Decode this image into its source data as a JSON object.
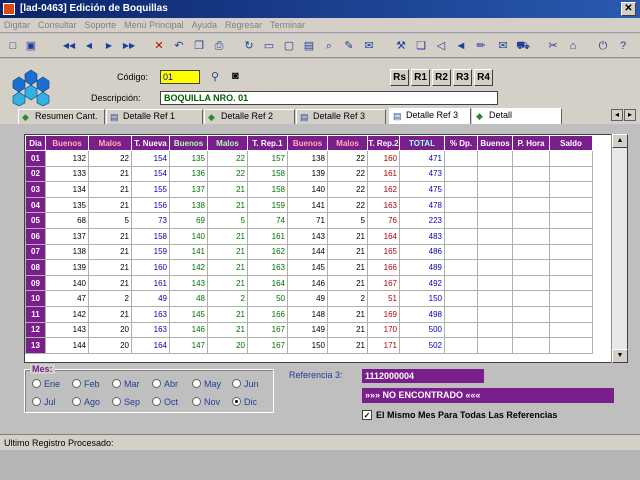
{
  "window": {
    "title": "[lad-0463]   Edición de Boquillas",
    "close": "✕"
  },
  "menu": [
    "Digitar",
    "Consultar",
    "Soporte",
    "Menú Principal",
    "Ayuda",
    "Regresar",
    "Terminar"
  ],
  "toolbar_icons": [
    "new-icon",
    "save-icon",
    "first-icon",
    "prev-icon",
    "next-icon",
    "last-icon",
    "delete-icon",
    "undo-icon",
    "copy-icon",
    "print-icon",
    "refresh-icon",
    "window-icon",
    "monitor-icon",
    "film-icon",
    "search-icon",
    "edit-icon",
    "mail-icon",
    "tool-icon",
    "book-icon",
    "back-icon",
    "sound-icon",
    "pencil-icon",
    "envelope-icon",
    "car-icon",
    "scissors-icon",
    "home-icon",
    "exit-icon",
    "help-icon"
  ],
  "form": {
    "codigo_label": "Código:",
    "codigo_value": "01",
    "descripcion_label": "Descripción:",
    "descripcion_value": "BOQUILLA NRO. 01",
    "report_buttons": [
      "Rs",
      "R1",
      "R2",
      "R3",
      "R4"
    ]
  },
  "tabs": [
    "Resumen Cant.",
    "Detalle Ref 1",
    "Detalle Ref 2",
    "Detalle Ref 3",
    "Detalle Ref 3",
    "Detall"
  ],
  "grid": {
    "headers": [
      "Dia",
      "Buenos",
      "Malos",
      "T. Nueva",
      "Buenos",
      "Malos",
      "T. Rep.1",
      "Buenos",
      "Malos",
      "T. Rep.2",
      "TOTAL",
      "% Dp.",
      "Buenos",
      "P. Hora",
      "Saldo"
    ],
    "rows": [
      [
        "01",
        "132",
        "22",
        "154",
        "135",
        "22",
        "157",
        "138",
        "22",
        "160",
        "471"
      ],
      [
        "02",
        "133",
        "21",
        "154",
        "136",
        "22",
        "158",
        "139",
        "22",
        "161",
        "473"
      ],
      [
        "03",
        "134",
        "21",
        "155",
        "137",
        "21",
        "158",
        "140",
        "22",
        "162",
        "475"
      ],
      [
        "04",
        "135",
        "21",
        "156",
        "138",
        "21",
        "159",
        "141",
        "22",
        "163",
        "478"
      ],
      [
        "05",
        "68",
        "5",
        "73",
        "69",
        "5",
        "74",
        "71",
        "5",
        "76",
        "223"
      ],
      [
        "06",
        "137",
        "21",
        "158",
        "140",
        "21",
        "161",
        "143",
        "21",
        "164",
        "483"
      ],
      [
        "07",
        "138",
        "21",
        "159",
        "141",
        "21",
        "162",
        "144",
        "21",
        "165",
        "486"
      ],
      [
        "08",
        "139",
        "21",
        "160",
        "142",
        "21",
        "163",
        "145",
        "21",
        "166",
        "489"
      ],
      [
        "09",
        "140",
        "21",
        "161",
        "143",
        "21",
        "164",
        "146",
        "21",
        "167",
        "492"
      ],
      [
        "10",
        "47",
        "2",
        "49",
        "48",
        "2",
        "50",
        "49",
        "2",
        "51",
        "150"
      ],
      [
        "11",
        "142",
        "21",
        "163",
        "145",
        "21",
        "166",
        "148",
        "21",
        "169",
        "498"
      ],
      [
        "12",
        "143",
        "20",
        "163",
        "146",
        "21",
        "167",
        "149",
        "21",
        "170",
        "500"
      ],
      [
        "13",
        "144",
        "20",
        "164",
        "147",
        "20",
        "167",
        "150",
        "21",
        "171",
        "502"
      ]
    ]
  },
  "mes": {
    "label": "Mes:",
    "options": [
      "Ene",
      "Feb",
      "Mar",
      "Abr",
      "May",
      "Jun",
      "Jul",
      "Ago",
      "Sep",
      "Oct",
      "Nov",
      "Dic"
    ],
    "selected": "Dic"
  },
  "referencia": {
    "label": "Referencia 3:",
    "value": "1112000004",
    "status": "»»» NO ENCONTRADO «««",
    "checkbox_label": "El Mismo Mes Para Todas Las Referencias",
    "checkbox_checked": true
  },
  "status": {
    "text": "Ultimo Registro Procesado:"
  }
}
